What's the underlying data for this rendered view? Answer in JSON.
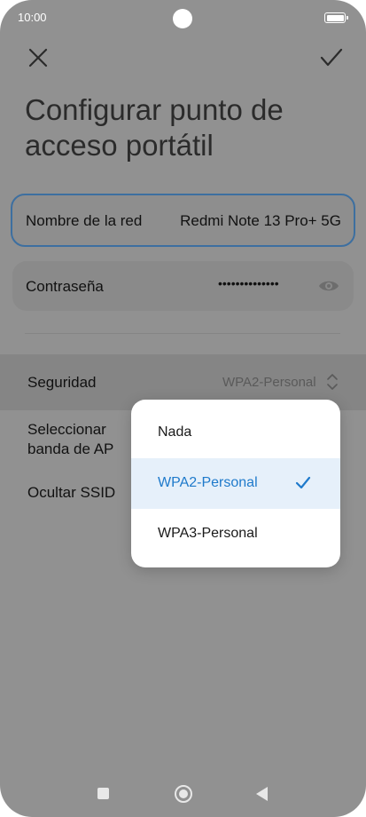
{
  "status_bar": {
    "time": "10:00"
  },
  "header": {
    "title": "Configurar punto de acceso portátil",
    "close_icon": "close-icon",
    "confirm_icon": "checkmark-icon"
  },
  "form": {
    "ssid": {
      "label": "Nombre de la red",
      "value": "Redmi Note 13 Pro+ 5G"
    },
    "password": {
      "label": "Contraseña",
      "value": "••••••••••••••",
      "toggle_icon": "eye-icon"
    },
    "security": {
      "label": "Seguridad",
      "value": "WPA2-Personal",
      "icon": "up-down-chevron-icon"
    },
    "ap_band": {
      "label": "Seleccionar banda de AP"
    },
    "hide_ssid": {
      "label": "Ocultar SSID"
    }
  },
  "security_dropdown": {
    "options": [
      {
        "label": "Nada",
        "selected": false
      },
      {
        "label": "WPA2-Personal",
        "selected": true
      },
      {
        "label": "WPA3-Personal",
        "selected": false
      }
    ],
    "selected_color": "#1f7acb"
  },
  "nav_bar": {
    "recents_icon": "square-icon",
    "home_icon": "home-circle-icon",
    "back_icon": "back-triangle-icon"
  }
}
